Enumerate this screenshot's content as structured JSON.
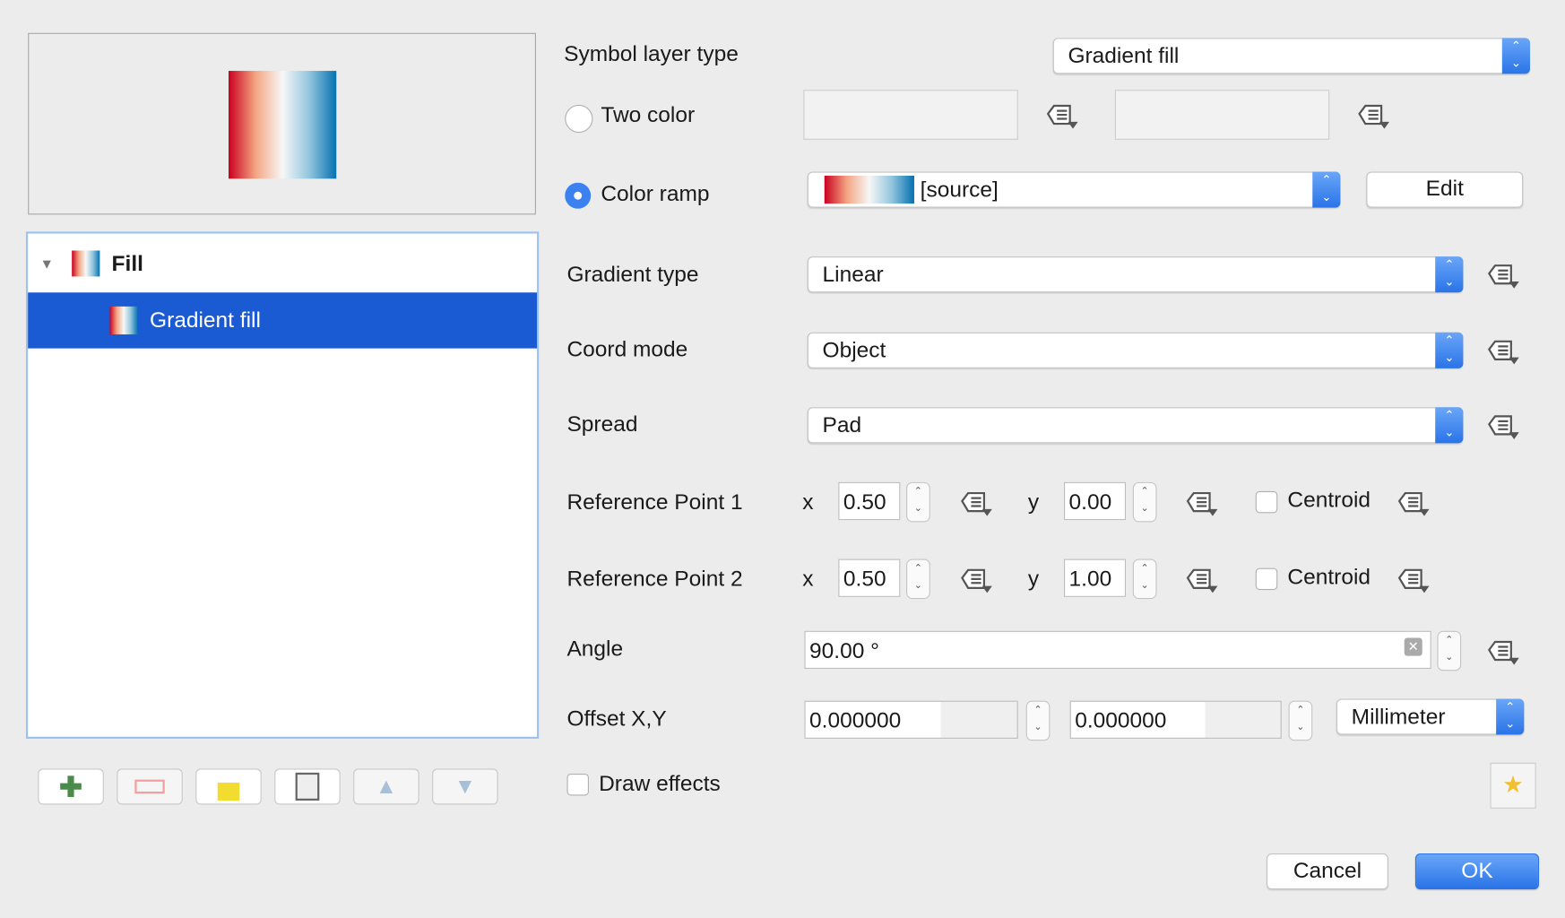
{
  "tree": {
    "parent": "Fill",
    "child": "Gradient fill"
  },
  "form": {
    "symbol_layer_type_label": "Symbol layer type",
    "symbol_layer_type": "Gradient fill",
    "two_color_label": "Two color",
    "color_ramp_label": "Color ramp",
    "color_ramp_value": "[source]",
    "edit_label": "Edit",
    "gradient_type_label": "Gradient type",
    "gradient_type": "Linear",
    "coord_mode_label": "Coord mode",
    "coord_mode": "Object",
    "spread_label": "Spread",
    "spread": "Pad",
    "ref1_label": "Reference Point 1",
    "ref1_x": "0.50",
    "ref1_y": "0.00",
    "ref2_label": "Reference Point 2",
    "ref2_x": "0.50",
    "ref2_y": "1.00",
    "x_label": "x",
    "y_label": "y",
    "centroid_label": "Centroid",
    "angle_label": "Angle",
    "angle": "90.00 °",
    "offset_label": "Offset X,Y",
    "offset_x": "0.000000",
    "offset_y": "0.000000",
    "unit": "Millimeter",
    "draw_effects_label": "Draw effects"
  },
  "buttons": {
    "cancel": "Cancel",
    "ok": "OK"
  },
  "colors": {
    "selection": "#1a5ad2",
    "accent": "#2a74e8",
    "ramp": [
      "#ca0020",
      "#f4a582",
      "#f7f7f7",
      "#92c5de",
      "#0571b0"
    ]
  }
}
